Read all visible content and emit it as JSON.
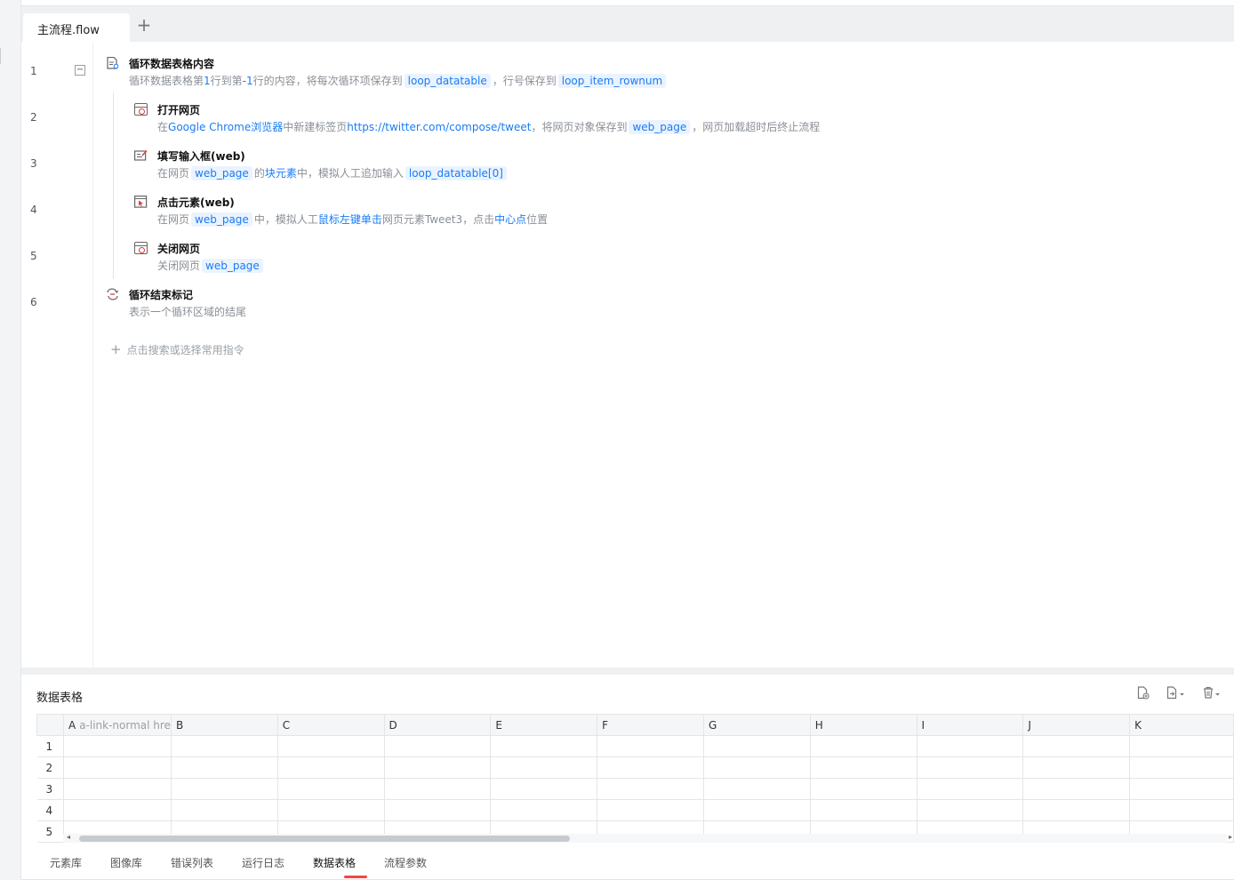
{
  "tabs": [
    {
      "label": "主流程.flow"
    }
  ],
  "tab_add_icon": "plus-icon",
  "line_numbers": [
    "1",
    "2",
    "3",
    "4",
    "5",
    "6"
  ],
  "steps": {
    "loop": {
      "title": "循环数据表格内容",
      "d1": "循环数据表格第",
      "d_n1": "1",
      "d2": "行到第",
      "d_n2": "-1",
      "d3": "行的内容，将每次循环项保存到",
      "var1": "loop_datatable",
      "d4": "，行号保存到",
      "var2": "loop_item_rownum"
    },
    "open": {
      "title": "打开网页",
      "d1": "在",
      "kw1": "Google Chrome浏览器",
      "d2": "中新建标签页",
      "kw2": "https://twitter.com/compose/tweet",
      "d3": "，将网页对象保存到",
      "var1": "web_page",
      "d4": "，网页加载超时后终止流程"
    },
    "fill": {
      "title": "填写输入框(web)",
      "d1": "在网页",
      "var1": "web_page",
      "d2": "的",
      "kw1": "块元素",
      "d3": "中，模拟人工追加输入",
      "var2": "loop_datatable[0]"
    },
    "click": {
      "title": "点击元素(web)",
      "d1": "在网页",
      "var1": "web_page",
      "d2": "中，模拟人工",
      "kw1": "鼠标左键单击",
      "d3": "网页元素Tweet3，点击",
      "kw2": "中心点",
      "d4": "位置"
    },
    "close": {
      "title": "关闭网页",
      "d1": "关闭网页",
      "var1": "web_page"
    },
    "end": {
      "title": "循环结束标记",
      "d1": "表示一个循环区域的结尾"
    }
  },
  "add_command": "点击搜索或选择常用指令",
  "panel": {
    "title": "数据表格",
    "tools": [
      "file-add-icon",
      "export-icon",
      "delete-icon"
    ]
  },
  "grid": {
    "columns": [
      "A",
      "B",
      "C",
      "D",
      "E",
      "F",
      "G",
      "H",
      "I",
      "J",
      "K"
    ],
    "col_a_hint": "a-link-normal hre",
    "rows": [
      "1",
      "2",
      "3",
      "4",
      "5"
    ]
  },
  "bottom_tabs": [
    "元素库",
    "图像库",
    "错误列表",
    "运行日志",
    "数据表格",
    "流程参数"
  ],
  "active_bottom_tab": "数据表格",
  "colors": {
    "accent": "#1a7cf5",
    "var_bg": "#eaf3ff",
    "active_indicator": "#f24646"
  }
}
